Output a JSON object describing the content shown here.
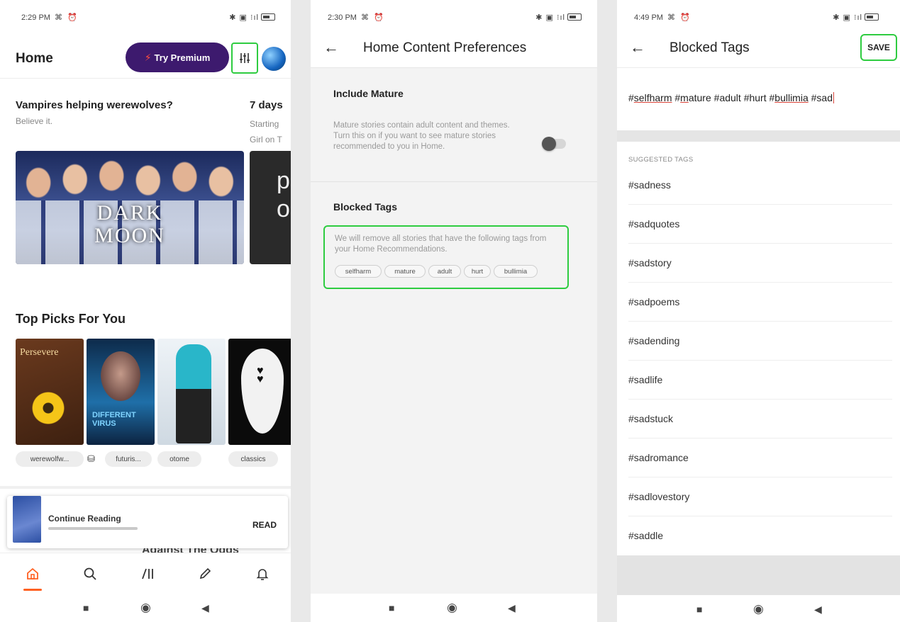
{
  "panel1": {
    "status": {
      "time": "2:29 PM",
      "icons": "⌘ ⏰",
      "right_icons": "✱ ▣ ⁝ıl"
    },
    "header": {
      "title": "Home",
      "premium_label": "Try Premium"
    },
    "featured": {
      "title": "Vampires helping werewolves?",
      "subtitle": "Believe it.",
      "hero_text": "DARK\nMOON",
      "title2": "7 days",
      "subtitle2": "Starting",
      "subtitle2b": "Girl on T",
      "hero2_text": "p\no"
    },
    "top_picks": {
      "title": "Top Picks For You",
      "book1_title": "Persevere",
      "book2_title": "DIFFERENT VIRUS",
      "tags": [
        "werewolfw...",
        "futuris...",
        "otome",
        "classics"
      ]
    },
    "continue": {
      "label": "Continue Reading",
      "action": "READ",
      "under": "Against The Odds"
    },
    "nav": [
      "home-icon",
      "search-icon",
      "library-icon",
      "pencil-icon",
      "bell-icon"
    ]
  },
  "panel2": {
    "status": {
      "time": "2:30 PM",
      "icons": "⌘ ⏰",
      "right_icons": "✱ ▣ ⁝ıl"
    },
    "title": "Home Content Preferences",
    "mature": {
      "heading": "Include Mature",
      "desc": "Mature stories contain adult content and themes. Turn this on if you want to see mature stories recommended to you in Home.",
      "enabled": false
    },
    "blocked": {
      "heading": "Blocked Tags",
      "desc": "We will remove all stories that have the following tags from your Home Recommendations.",
      "tags": [
        "selfharm",
        "mature",
        "adult",
        "hurt",
        "bullimia"
      ]
    }
  },
  "panel3": {
    "status": {
      "time": "4:49 PM",
      "icons": "⌘ ⏰",
      "right_icons": "✱ ▣ ⁝ıl"
    },
    "title": "Blocked Tags",
    "save_label": "SAVE",
    "input": {
      "t1": "#",
      "t1u": "selfharm",
      "t2": " #",
      "t2u": "m",
      "t2r": "ature",
      "t3": " #adult #hurt #",
      "t3u": "bullimia",
      "t4": " #sad"
    },
    "suggested_label": "SUGGESTED TAGS",
    "suggestions": [
      "#sadness",
      "#sadquotes",
      "#sadstory",
      "#sadpoems",
      "#sadending",
      "#sadlife",
      "#sadstuck",
      "#sadromance",
      "#sadlovestory",
      "#saddle"
    ]
  },
  "colors": {
    "accent": "#ff6122",
    "premium": "#3d1a6e",
    "highlight": "#2ecc40"
  }
}
